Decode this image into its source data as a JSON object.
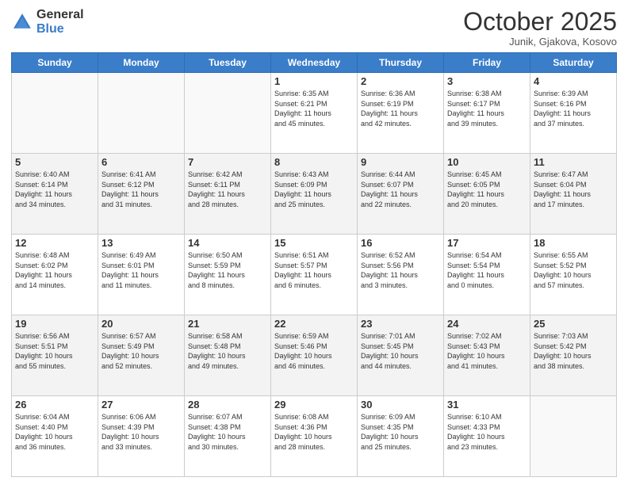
{
  "header": {
    "logo_general": "General",
    "logo_blue": "Blue",
    "month": "October 2025",
    "location": "Junik, Gjakova, Kosovo"
  },
  "weekdays": [
    "Sunday",
    "Monday",
    "Tuesday",
    "Wednesday",
    "Thursday",
    "Friday",
    "Saturday"
  ],
  "weeks": [
    [
      {
        "day": "",
        "info": ""
      },
      {
        "day": "",
        "info": ""
      },
      {
        "day": "",
        "info": ""
      },
      {
        "day": "1",
        "info": "Sunrise: 6:35 AM\nSunset: 6:21 PM\nDaylight: 11 hours\nand 45 minutes."
      },
      {
        "day": "2",
        "info": "Sunrise: 6:36 AM\nSunset: 6:19 PM\nDaylight: 11 hours\nand 42 minutes."
      },
      {
        "day": "3",
        "info": "Sunrise: 6:38 AM\nSunset: 6:17 PM\nDaylight: 11 hours\nand 39 minutes."
      },
      {
        "day": "4",
        "info": "Sunrise: 6:39 AM\nSunset: 6:16 PM\nDaylight: 11 hours\nand 37 minutes."
      }
    ],
    [
      {
        "day": "5",
        "info": "Sunrise: 6:40 AM\nSunset: 6:14 PM\nDaylight: 11 hours\nand 34 minutes."
      },
      {
        "day": "6",
        "info": "Sunrise: 6:41 AM\nSunset: 6:12 PM\nDaylight: 11 hours\nand 31 minutes."
      },
      {
        "day": "7",
        "info": "Sunrise: 6:42 AM\nSunset: 6:11 PM\nDaylight: 11 hours\nand 28 minutes."
      },
      {
        "day": "8",
        "info": "Sunrise: 6:43 AM\nSunset: 6:09 PM\nDaylight: 11 hours\nand 25 minutes."
      },
      {
        "day": "9",
        "info": "Sunrise: 6:44 AM\nSunset: 6:07 PM\nDaylight: 11 hours\nand 22 minutes."
      },
      {
        "day": "10",
        "info": "Sunrise: 6:45 AM\nSunset: 6:05 PM\nDaylight: 11 hours\nand 20 minutes."
      },
      {
        "day": "11",
        "info": "Sunrise: 6:47 AM\nSunset: 6:04 PM\nDaylight: 11 hours\nand 17 minutes."
      }
    ],
    [
      {
        "day": "12",
        "info": "Sunrise: 6:48 AM\nSunset: 6:02 PM\nDaylight: 11 hours\nand 14 minutes."
      },
      {
        "day": "13",
        "info": "Sunrise: 6:49 AM\nSunset: 6:01 PM\nDaylight: 11 hours\nand 11 minutes."
      },
      {
        "day": "14",
        "info": "Sunrise: 6:50 AM\nSunset: 5:59 PM\nDaylight: 11 hours\nand 8 minutes."
      },
      {
        "day": "15",
        "info": "Sunrise: 6:51 AM\nSunset: 5:57 PM\nDaylight: 11 hours\nand 6 minutes."
      },
      {
        "day": "16",
        "info": "Sunrise: 6:52 AM\nSunset: 5:56 PM\nDaylight: 11 hours\nand 3 minutes."
      },
      {
        "day": "17",
        "info": "Sunrise: 6:54 AM\nSunset: 5:54 PM\nDaylight: 11 hours\nand 0 minutes."
      },
      {
        "day": "18",
        "info": "Sunrise: 6:55 AM\nSunset: 5:52 PM\nDaylight: 10 hours\nand 57 minutes."
      }
    ],
    [
      {
        "day": "19",
        "info": "Sunrise: 6:56 AM\nSunset: 5:51 PM\nDaylight: 10 hours\nand 55 minutes."
      },
      {
        "day": "20",
        "info": "Sunrise: 6:57 AM\nSunset: 5:49 PM\nDaylight: 10 hours\nand 52 minutes."
      },
      {
        "day": "21",
        "info": "Sunrise: 6:58 AM\nSunset: 5:48 PM\nDaylight: 10 hours\nand 49 minutes."
      },
      {
        "day": "22",
        "info": "Sunrise: 6:59 AM\nSunset: 5:46 PM\nDaylight: 10 hours\nand 46 minutes."
      },
      {
        "day": "23",
        "info": "Sunrise: 7:01 AM\nSunset: 5:45 PM\nDaylight: 10 hours\nand 44 minutes."
      },
      {
        "day": "24",
        "info": "Sunrise: 7:02 AM\nSunset: 5:43 PM\nDaylight: 10 hours\nand 41 minutes."
      },
      {
        "day": "25",
        "info": "Sunrise: 7:03 AM\nSunset: 5:42 PM\nDaylight: 10 hours\nand 38 minutes."
      }
    ],
    [
      {
        "day": "26",
        "info": "Sunrise: 6:04 AM\nSunset: 4:40 PM\nDaylight: 10 hours\nand 36 minutes."
      },
      {
        "day": "27",
        "info": "Sunrise: 6:06 AM\nSunset: 4:39 PM\nDaylight: 10 hours\nand 33 minutes."
      },
      {
        "day": "28",
        "info": "Sunrise: 6:07 AM\nSunset: 4:38 PM\nDaylight: 10 hours\nand 30 minutes."
      },
      {
        "day": "29",
        "info": "Sunrise: 6:08 AM\nSunset: 4:36 PM\nDaylight: 10 hours\nand 28 minutes."
      },
      {
        "day": "30",
        "info": "Sunrise: 6:09 AM\nSunset: 4:35 PM\nDaylight: 10 hours\nand 25 minutes."
      },
      {
        "day": "31",
        "info": "Sunrise: 6:10 AM\nSunset: 4:33 PM\nDaylight: 10 hours\nand 23 minutes."
      },
      {
        "day": "",
        "info": ""
      }
    ]
  ]
}
